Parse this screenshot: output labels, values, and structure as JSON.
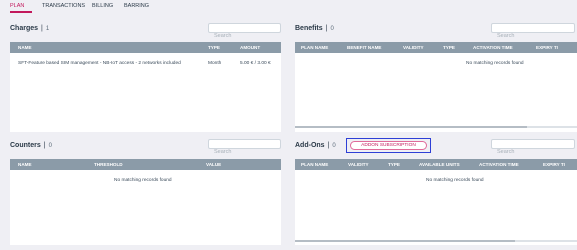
{
  "tabs": [
    {
      "label": "PLAN"
    },
    {
      "label": "TRANSACTIONS"
    },
    {
      "label": "BILLING"
    },
    {
      "label": "BARRING"
    }
  ],
  "charges": {
    "title": "Charges",
    "count": "1",
    "search_placeholder": "Search",
    "columns": [
      "NAME",
      "TYPE",
      "AMOUNT"
    ],
    "rows": [
      [
        "SFT-Feature based SIM management - NB-IoT access - 2 networks included",
        "Month",
        "5.00 € / 3.00 €"
      ]
    ]
  },
  "benefits": {
    "title": "Benefits",
    "count": "0",
    "search_placeholder": "Search",
    "columns": [
      "PLAN NAME",
      "BENEFIT NAME",
      "VALIDITY",
      "TYPE",
      "ACTIVATION TIME",
      "EXPIRY TI"
    ],
    "empty_text": "No matching records found"
  },
  "counters": {
    "title": "Counters",
    "count": "0",
    "search_placeholder": "Search",
    "columns": [
      "NAME",
      "THRESHOLD",
      "VALUE"
    ],
    "empty_text": "No matching records found"
  },
  "addons": {
    "title": "Add-Ons",
    "count": "0",
    "button_label": "ADDON SUBSCRIPTION",
    "search_placeholder": "Search",
    "columns": [
      "PLAN NAME",
      "VALIDITY",
      "TYPE",
      "AVAILABLE UNITS",
      "ACTIVATION TIME",
      "EXPIRY TI"
    ],
    "empty_text": "No matching records found"
  },
  "colors": {
    "accent": "#c2185b",
    "table_header": "#8b9ba8",
    "highlight_box": "#2e3fd6"
  }
}
